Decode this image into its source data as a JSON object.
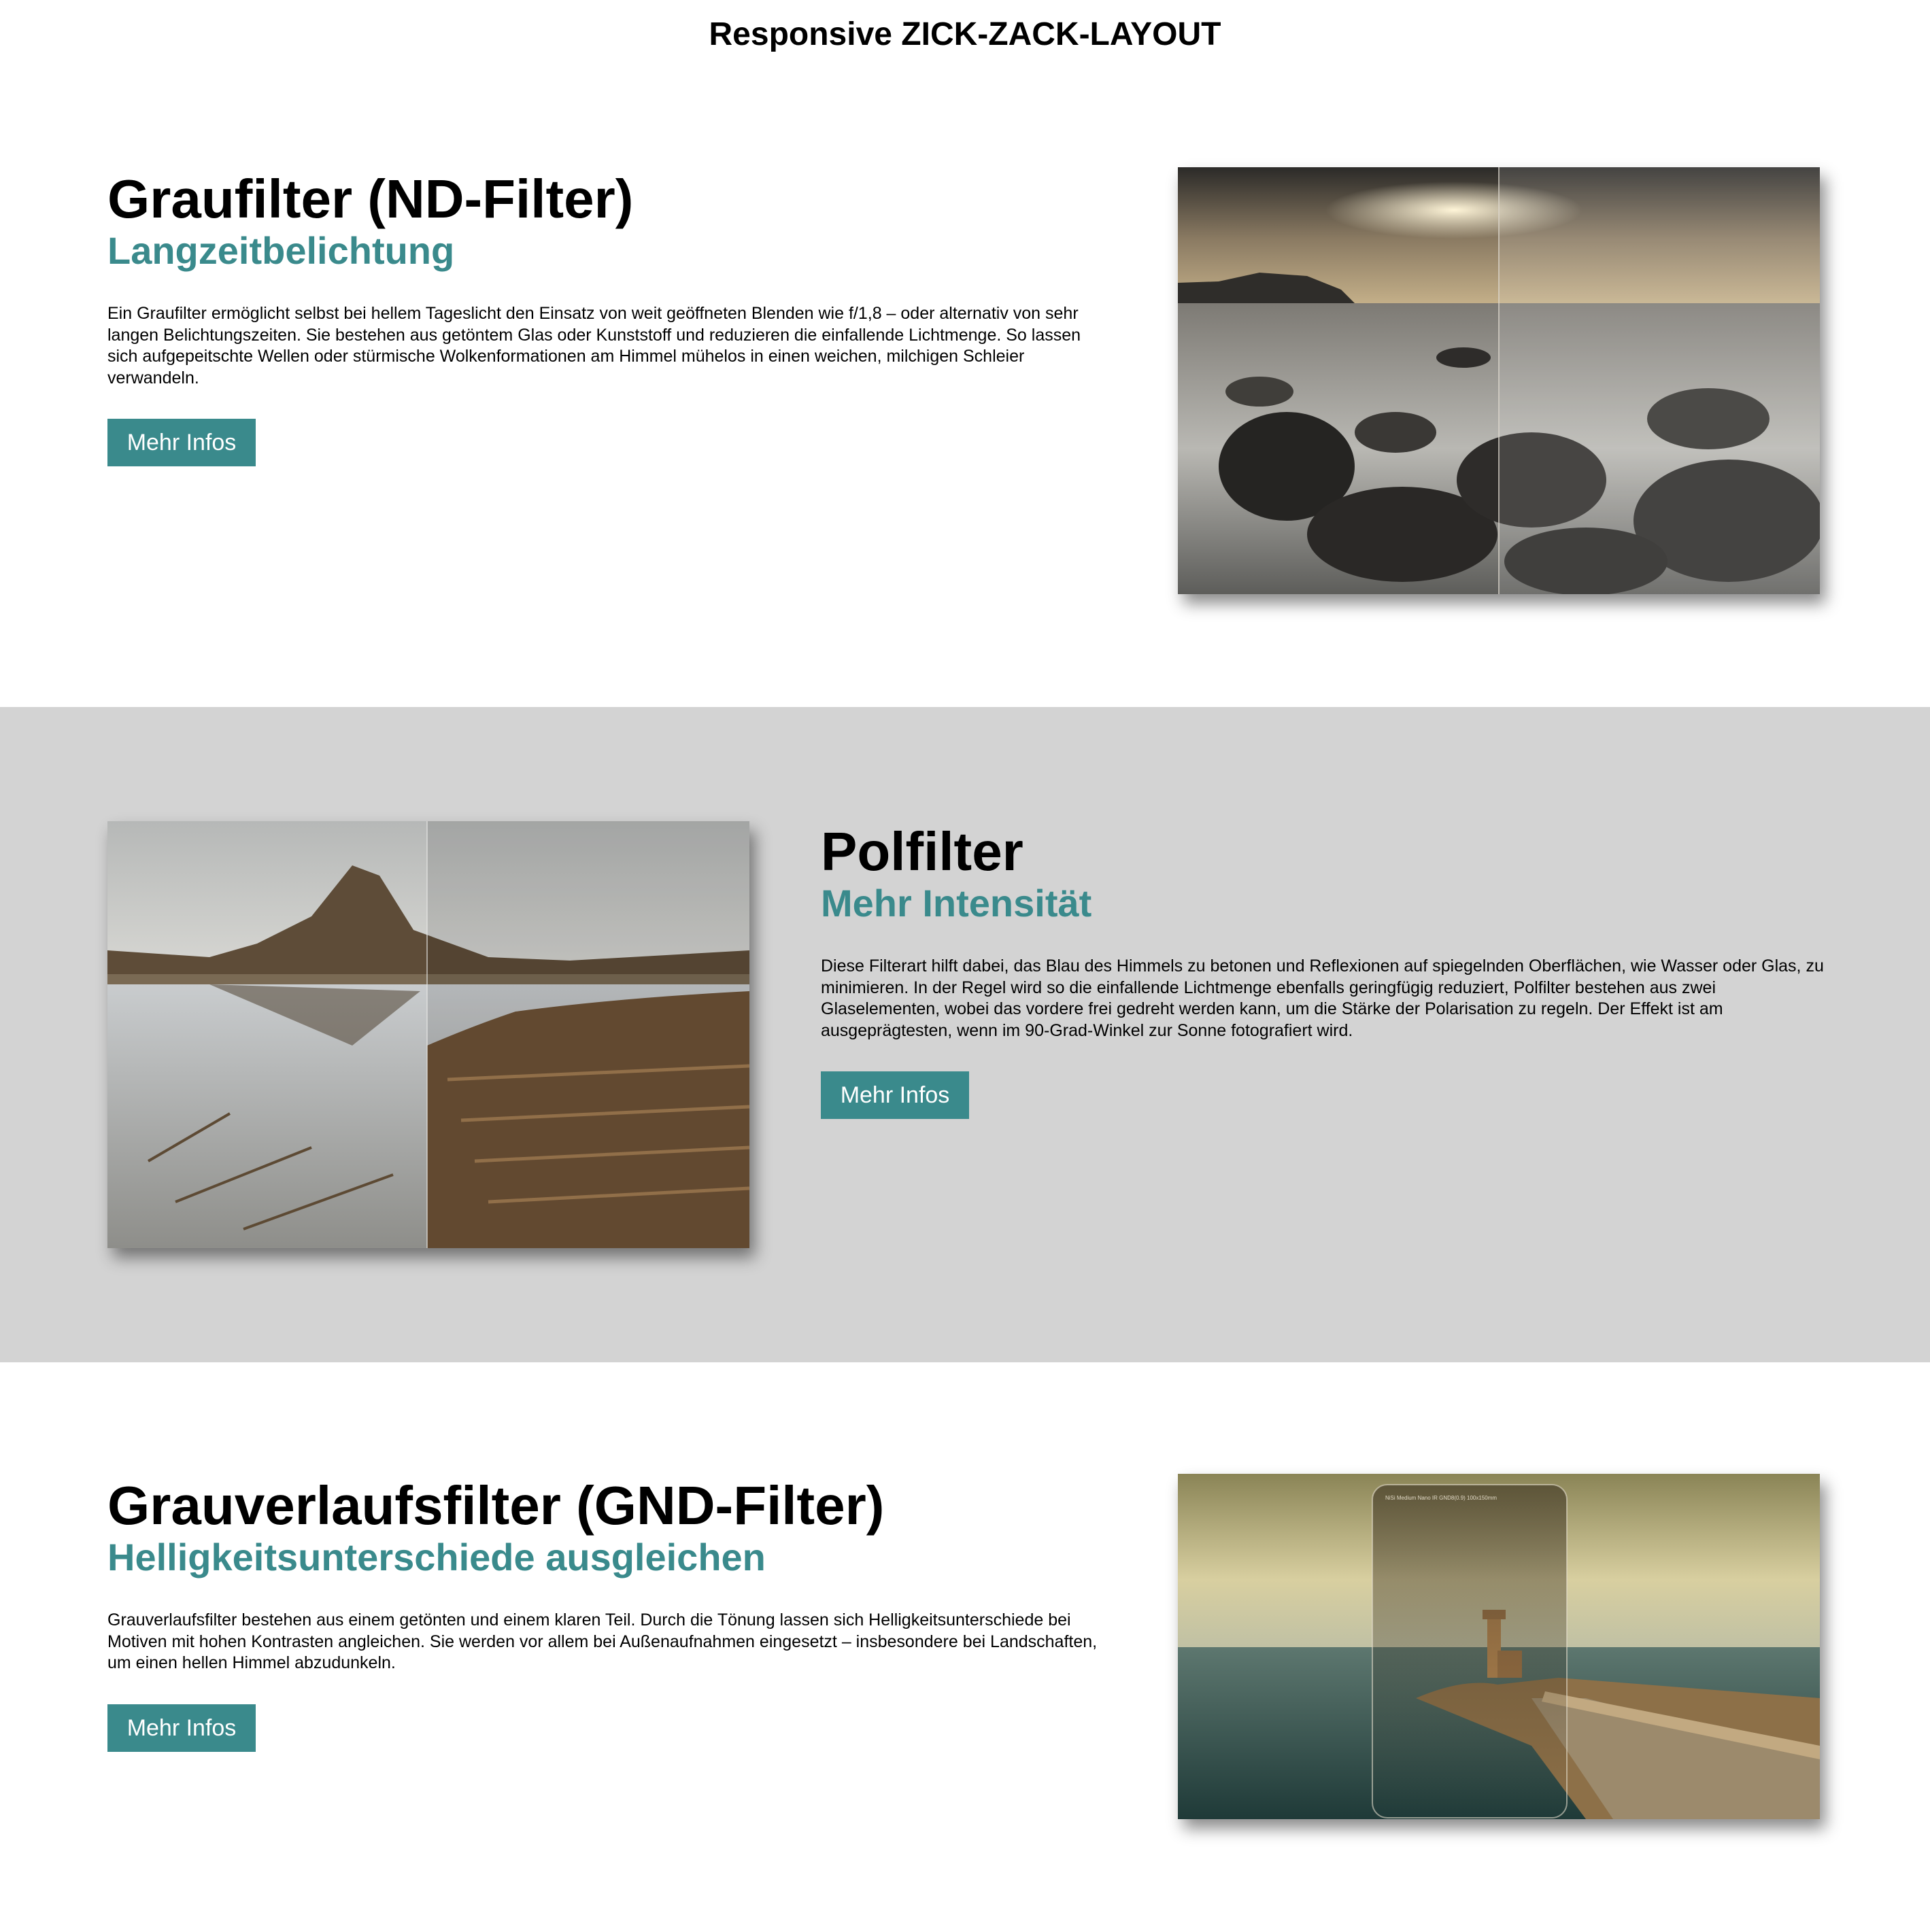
{
  "page": {
    "title": "Responsive ZICK-ZACK-LAYOUT"
  },
  "sections": [
    {
      "heading": "Graufilter (ND-Filter)",
      "subheading": "Langzeitbelichtung",
      "body": "Ein Graufilter ermöglicht selbst bei hellem Tageslicht den Einsatz von weit geöffneten Blenden wie f/1,8 – oder alternativ von sehr langen Belichtungszeiten. Sie bestehen aus getöntem Glas oder Kunststoff und reduzieren die einfallende Lichtmenge. So lassen sich aufgepeitschte Wellen oder stürmische Wolkenformationen am Himmel mühelos in einen weichen, milchigen Schleier verwandeln.",
      "button": "Mehr Infos",
      "image_icon": "seascape-rocks-photo"
    },
    {
      "heading": "Polfilter",
      "subheading": "Mehr Intensität",
      "body": "Diese Filterart hilft dabei, das Blau des Himmels zu betonen und Reflexionen auf spiegelnden Oberflächen, wie Wasser oder Glas, zu minimieren. In der Regel wird so die einfallende Lichtmenge ebenfalls geringfügig reduziert, Polfilter bestehen aus zwei Glaselementen, wobei das vordere frei gedreht werden kann, um die Stärke der Polarisation zu regeln. Der Effekt ist am ausgeprägtesten, wenn im 90-Grad-Winkel zur Sonne fotografiert wird.",
      "button": "Mehr Infos",
      "image_icon": "mountain-reflection-photo"
    },
    {
      "heading": "Grauverlaufsfilter (GND-Filter)",
      "subheading": "Helligkeitsunterschiede ausgleichen",
      "body": "Grauverlaufsfilter bestehen aus einem getönten und einem klaren Teil. Durch die Tönung lassen sich Helligkeitsunterschiede bei Motiven mit hohen Kontrasten angleichen. Sie werden vor allem bei Außenaufnahmen eingesetzt – insbesondere bei Landschaften, um einen hellen Himmel abzudunkeln.",
      "button": "Mehr Infos",
      "image_icon": "lighthouse-filter-photo",
      "filter_label": "NiSi   Medium   Nano IR GND8(0.9)   100x150mm"
    }
  ],
  "colors": {
    "accent": "#3a8a8c",
    "alt_section_bg": "#d3d3d3",
    "page_bg": "#ffffff"
  }
}
